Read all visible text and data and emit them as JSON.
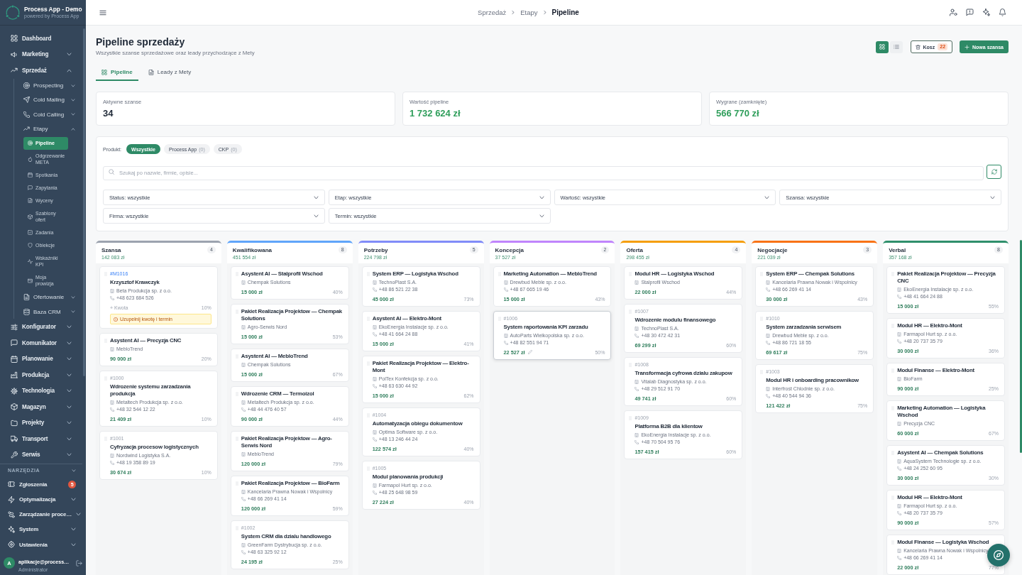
{
  "sidebar": {
    "brand": {
      "title": "Process App - Demo",
      "subtitle": "powered by Process App"
    },
    "items": [
      {
        "label": "Dashboard",
        "kind": "link",
        "selected": false
      },
      {
        "label": "Marketing",
        "kind": "group",
        "expanded": false,
        "selected": false
      },
      {
        "label": "Sprzedaż",
        "kind": "group",
        "expanded": true,
        "selected": false,
        "children": [
          {
            "label": "Prospecting",
            "kind": "group",
            "expanded": false,
            "selected": false
          },
          {
            "label": "Cold Mailing",
            "kind": "group",
            "expanded": false,
            "selected": false
          },
          {
            "label": "Cold Calling",
            "kind": "group",
            "expanded": false,
            "selected": false
          },
          {
            "label": "Etapy",
            "kind": "group",
            "expanded": true,
            "selected": false,
            "children": [
              {
                "label": "Pipeline",
                "kind": "link",
                "selected": true
              },
              {
                "label": "Odgrzewanie META",
                "kind": "link",
                "selected": false
              },
              {
                "label": "Spotkania",
                "kind": "link",
                "selected": false
              },
              {
                "label": "Zapytania",
                "kind": "link",
                "selected": false
              },
              {
                "label": "Wyceny",
                "kind": "link",
                "selected": false
              },
              {
                "label": "Szablony ofert",
                "kind": "link",
                "selected": false
              },
              {
                "label": "Zadania",
                "kind": "link",
                "selected": false
              },
              {
                "label": "Obiekcje",
                "kind": "link",
                "selected": false
              },
              {
                "label": "Wskaźniki KPI",
                "kind": "link",
                "selected": false
              },
              {
                "label": "Moja prowizja",
                "kind": "link",
                "selected": false
              }
            ]
          },
          {
            "label": "Ofertowanie",
            "kind": "group",
            "expanded": false,
            "selected": false
          },
          {
            "label": "Baza CRM",
            "kind": "group",
            "expanded": false,
            "selected": false
          }
        ]
      },
      {
        "label": "Konfigurator",
        "kind": "group",
        "expanded": false,
        "selected": false
      },
      {
        "label": "Komunikator",
        "kind": "group",
        "expanded": false,
        "selected": false
      },
      {
        "label": "Planowanie",
        "kind": "group",
        "expanded": false,
        "selected": false
      },
      {
        "label": "Produkcja",
        "kind": "group",
        "expanded": false,
        "selected": false
      },
      {
        "label": "Technologia",
        "kind": "group",
        "expanded": false,
        "selected": false
      },
      {
        "label": "Magazyn",
        "kind": "group",
        "expanded": false,
        "selected": false
      },
      {
        "label": "Projekty",
        "kind": "group",
        "expanded": false,
        "selected": false
      },
      {
        "label": "Transport",
        "kind": "group",
        "expanded": false,
        "selected": false
      },
      {
        "label": "Serwis",
        "kind": "group",
        "expanded": false,
        "selected": false
      }
    ],
    "tools": {
      "title": "NARZĘDZIA",
      "items": [
        {
          "label": "Zgłoszenia",
          "kind": "link",
          "selected": false,
          "badge": "5"
        },
        {
          "label": "Optymalizacja",
          "kind": "group",
          "expanded": false,
          "selected": false
        },
        {
          "label": "Zarządzanie proce…",
          "kind": "group",
          "expanded": false,
          "selected": false
        },
        {
          "label": "System",
          "kind": "group",
          "expanded": false,
          "selected": false
        },
        {
          "label": "Ustawienia",
          "kind": "group",
          "expanded": false,
          "selected": false
        }
      ]
    },
    "user": {
      "avatar": "A",
      "name": "aplikacje@process…",
      "role": "Administrator"
    }
  },
  "header": {
    "breadcrumb": [
      "Sprzedaż",
      "Etapy",
      "Pipeline"
    ]
  },
  "page": {
    "title": "Pipeline sprzedaży",
    "subtitle": "Wszystkie szanse sprzedażowe oraz leady przychodzące z Mety",
    "view_toggle": [
      {
        "selected": true
      },
      {
        "selected": false
      }
    ],
    "trash_button": {
      "label": "Kosz",
      "count": "22"
    },
    "new_button": {
      "label": "Nowa szansa"
    },
    "tabs": [
      {
        "label": "Pipeline",
        "selected": true
      },
      {
        "label": "Leady z Mety",
        "selected": false
      }
    ]
  },
  "stats": [
    {
      "label": "Aktywne szanse",
      "value": "34",
      "color": "#1f2937"
    },
    {
      "label": "Wartość pipeline",
      "value": "1 732 624 zł",
      "color": "#2f9e5b"
    },
    {
      "label": "Wygrane (zamknięte)",
      "value": "566 770 zł",
      "color": "#2f9e5b"
    }
  ],
  "filters": {
    "product_label": "Produkt:",
    "products": [
      {
        "label": "Wszystkie",
        "selected": true
      },
      {
        "label": "Process App",
        "count": "(0)",
        "selected": false
      },
      {
        "label": "CKP",
        "count": "(0)",
        "selected": false
      }
    ],
    "search": {
      "placeholder": "Szukaj po nazwie, firmie, opisie..."
    },
    "selects": [
      "Status: wszystkie",
      "Etap: wszystkie",
      "Wartość: wszystkie",
      "Szansa: wszystkie",
      "Firma: wszystkie",
      "Termin: wszystkie"
    ]
  },
  "kanban": {
    "columns": [
      {
        "title": "Szansa",
        "total": "142 083 zł",
        "count": "4",
        "color": "#9ca3af",
        "cards": [
          {
            "kind": "lead",
            "id": "#M1016",
            "title": "Krzysztof Krawczyk",
            "company": "Beta Produkcja sp. z o.o.",
            "phone": "+48 623 684 526",
            "amount_hint": "+ Kwota",
            "probability": "10%",
            "warning": "Uzupełnij kwotę i termin",
            "hovered": false
          },
          {
            "kind": "deal",
            "title": "Asystent AI — Precyzja CNC",
            "company": "MebloTrend",
            "amount": "90 000 zł",
            "probability": "20%",
            "hovered": false
          },
          {
            "kind": "deal",
            "id": "#1000",
            "title": "Wdrozenie systemu zarzadzania produkcja",
            "company": "Metaltech Produkcja sp. z o.o.",
            "phone": "+48 32 544 12 22",
            "amount": "21 409 zł",
            "probability": "10%",
            "hovered": false
          },
          {
            "kind": "deal",
            "id": "#1001",
            "title": "Cyfryzacja procesow logistycznych",
            "company": "Nordwind Logistyka S.A.",
            "phone": "+48 19 358 89 19",
            "amount": "30 674 zł",
            "probability": "10%",
            "hovered": false
          }
        ]
      },
      {
        "title": "Kwalifikowana",
        "total": "451 554 zł",
        "count": "8",
        "color": "#60a5fa",
        "cards": [
          {
            "kind": "deal",
            "title": "Asystent AI — Stalprofil Wschod",
            "company": "Chempak Solutions",
            "amount": "15 000 zł",
            "probability": "40%",
            "hovered": false
          },
          {
            "kind": "deal",
            "title": "Pakiet Realizacja Projektow — Chempak Solutions",
            "company": "Agro-Serwis Nord",
            "amount": "15 000 zł",
            "probability": "53%",
            "hovered": false
          },
          {
            "kind": "deal",
            "title": "Asystent AI — MebloTrend",
            "company": "Chempak Solutions",
            "amount": "15 000 zł",
            "probability": "67%",
            "hovered": false
          },
          {
            "kind": "deal",
            "title": "Wdrozenie CRM — Termoizol",
            "company": "Metaltech Produkcja sp. z o.o.",
            "phone": "+48 44 476 40 57",
            "amount": "90 000 zł",
            "probability": "44%",
            "hovered": false
          },
          {
            "kind": "deal",
            "title": "Pakiet Realizacja Projektow — Agro-Serwis Nord",
            "company": "MebloTrend",
            "amount": "120 000 zł",
            "probability": "79%",
            "hovered": false
          },
          {
            "kind": "deal",
            "title": "Pakiet Realizacja Projektow — BioFarm",
            "company": "Kancelaria Prawna Nowak i Wspolnicy",
            "phone": "+48 66 269 41 14",
            "amount": "120 000 zł",
            "probability": "59%",
            "hovered": false
          },
          {
            "kind": "deal",
            "id": "#1002",
            "title": "System CRM dla dzialu handlowego",
            "company": "GreenFarm Dystrybucja sp. z o.o.",
            "phone": "+48 63 325 92 12",
            "amount": "24 195 zł",
            "probability": "25%",
            "hovered": false
          }
        ]
      },
      {
        "title": "Potrzeby",
        "total": "224 798 zł",
        "count": "5",
        "color": "#818cf8",
        "cards": [
          {
            "kind": "deal",
            "title": "System ERP — Logistyka Wschod",
            "company": "TechnoPlast S.A.",
            "phone": "+48 86 521 22 38",
            "amount": "45 000 zł",
            "probability": "73%",
            "hovered": false
          },
          {
            "kind": "deal",
            "title": "Asystent AI — Elektro-Mont",
            "company": "EkoEnergia Instalacje sp. z o.o.",
            "phone": "+48 41 664 24 88",
            "amount": "15 000 zł",
            "probability": "41%",
            "hovered": false
          },
          {
            "kind": "deal",
            "title": "Pakiet Realizacja Projektow — Elektro-Mont",
            "company": "PolTex Konfekcja sp. z o.o.",
            "phone": "+48 63 630 44 92",
            "amount": "15 000 zł",
            "probability": "62%",
            "hovered": false
          },
          {
            "kind": "deal",
            "id": "#1004",
            "title": "Automatyzacja obiegu dokumentow",
            "company": "Optima Software sp. z o.o.",
            "phone": "+48 13 246 44 24",
            "amount": "122 574 zł",
            "probability": "40%",
            "hovered": false
          },
          {
            "kind": "deal",
            "id": "#1005",
            "title": "Modul planowania produkcji",
            "company": "Farmapol Hurt sp. z o.o.",
            "phone": "+48 25 648 98 59",
            "amount": "27 224 zł",
            "probability": "40%",
            "hovered": false
          }
        ]
      },
      {
        "title": "Koncepcja",
        "total": "37 527 zł",
        "count": "2",
        "color": "#c084fc",
        "cards": [
          {
            "kind": "deal",
            "title": "Marketing Automation — MebloTrend",
            "company": "Drewbud Meble sp. z o.o.",
            "phone": "+48 67 665 19 46",
            "amount": "15 000 zł",
            "probability": "43%",
            "hovered": false
          },
          {
            "kind": "deal",
            "id": "#1006",
            "title": "System raportowania KPI zarzadu",
            "company": "AutoParts Wielkopolska sp. z o.o.",
            "phone": "+48 82 551 94 71",
            "amount": "22 527 zł",
            "probability": "50%",
            "hovered": true
          }
        ]
      },
      {
        "title": "Oferta",
        "total": "298 455 zł",
        "count": "4",
        "color": "#f59e0b",
        "cards": [
          {
            "kind": "deal",
            "title": "Modul HR — Logistyka Wschod",
            "company": "Stalprofil Wschod",
            "amount": "22 000 zł",
            "probability": "44%",
            "hovered": false
          },
          {
            "kind": "deal",
            "id": "#1007",
            "title": "Wdrozenie modulu finansowego",
            "company": "TechnoPlast S.A.",
            "phone": "+48 30 472 42 31",
            "amount": "69 299 zł",
            "probability": "60%",
            "hovered": false
          },
          {
            "kind": "deal",
            "id": "#1008",
            "title": "Transformacja cyfrowa dzialu zakupow",
            "company": "Vitalab Diagnostyka sp. z o.o.",
            "phone": "+48 29 512 91 70",
            "amount": "49 741 zł",
            "probability": "60%",
            "hovered": false
          },
          {
            "kind": "deal",
            "id": "#1009",
            "title": "Platforma B2B dla klientow",
            "company": "EkoEnergia Instalacje sp. z o.o.",
            "phone": "+48 70 504 95 76",
            "amount": "157 415 zł",
            "probability": "60%",
            "hovered": false
          }
        ]
      },
      {
        "title": "Negocjacje",
        "total": "221 039 zł",
        "count": "3",
        "color": "#f97316",
        "cards": [
          {
            "kind": "deal",
            "title": "System ERP — Chempak Solutions",
            "company": "Kancelaria Prawna Nowak i Wspolnicy",
            "phone": "+48 66 269 41 14",
            "amount": "30 000 zł",
            "probability": "43%",
            "hovered": false
          },
          {
            "kind": "deal",
            "id": "#1010",
            "title": "System zarzadzania serwisem",
            "company": "Drewbud Meble sp. z o.o.",
            "phone": "+48 86 721 18 55",
            "amount": "69 617 zł",
            "probability": "75%",
            "hovered": false
          },
          {
            "kind": "deal",
            "id": "#1003",
            "title": "Modul HR i onboarding pracownikow",
            "company": "Interfrost Chlodnie sp. z o.o.",
            "phone": "+48 40 544 94 36",
            "amount": "121 422 zł",
            "probability": "75%",
            "hovered": false
          }
        ]
      },
      {
        "title": "Verbal",
        "total": "357 168 zł",
        "count": "8",
        "color": "#2f8f6b",
        "cards": [
          {
            "kind": "deal",
            "title": "Pakiet Realizacja Projektow — Precyzja CNC",
            "company": "EkoEnergia Instalacje sp. z o.o.",
            "phone": "+48 41 664 24 88",
            "amount": "15 000 zł",
            "probability": "55%",
            "hovered": false
          },
          {
            "kind": "deal",
            "title": "Modul HR — Elektro-Mont",
            "company": "Farmapol Hurt sp. z o.o.",
            "phone": "+48 20 737 35 79",
            "amount": "30 000 zł",
            "probability": "36%",
            "hovered": false
          },
          {
            "kind": "deal",
            "title": "Modul Finanse — Elektro-Mont",
            "company": "BioFarm",
            "amount": "90 000 zł",
            "probability": "25%",
            "hovered": false
          },
          {
            "kind": "deal",
            "title": "Marketing Automation — Logistyka Wschod",
            "company": "Precyzja CNC",
            "amount": "60 000 zł",
            "probability": "67%",
            "hovered": false
          },
          {
            "kind": "deal",
            "title": "Asystent AI — Chempak Solutions",
            "company": "AquaSystem Technologie sp. z o.o.",
            "phone": "+48 24 252 60 95",
            "amount": "30 000 zł",
            "probability": "30%",
            "hovered": false
          },
          {
            "kind": "deal",
            "title": "Modul HR — Elektro-Mont",
            "company": "Farmapol Hurt sp. z o.o.",
            "phone": "+48 20 737 35 79",
            "amount": "90 000 zł",
            "probability": "57%",
            "hovered": false
          },
          {
            "kind": "deal",
            "title": "Modul Finanse — Logistyka Wschod",
            "company": "Kancelaria Prawna Nowak i Wspolnicy",
            "phone": "+48 66 269 41 14",
            "amount": "22 000 zł",
            "probability": "77%",
            "hovered": false
          }
        ]
      }
    ]
  }
}
